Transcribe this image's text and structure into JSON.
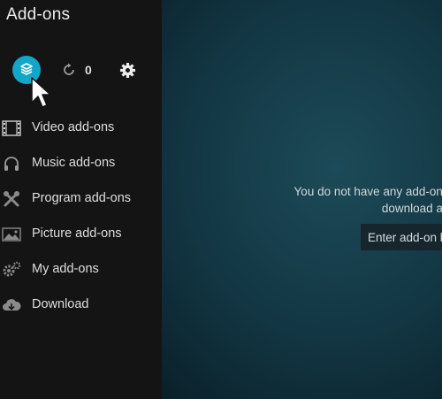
{
  "header": {
    "title": "Add-ons"
  },
  "toolbar": {
    "update_count": "0"
  },
  "menu": {
    "items": [
      {
        "label": "Video add-ons",
        "icon": "film-icon"
      },
      {
        "label": "Music add-ons",
        "icon": "headphones-icon"
      },
      {
        "label": "Program add-ons",
        "icon": "tools-icon"
      },
      {
        "label": "Picture add-ons",
        "icon": "picture-icon"
      },
      {
        "label": "My add-ons",
        "icon": "gears-icon"
      },
      {
        "label": "Download",
        "icon": "cloud-download-icon"
      }
    ]
  },
  "main": {
    "message_line1": "You do not have any add-ons of this type in",
    "message_line2": "download add-ons created",
    "enter_button_label": "Enter add-on b"
  },
  "colors": {
    "accent": "#12a6c9",
    "sidebar_bg": "#141414",
    "main_bg": "#123643"
  }
}
